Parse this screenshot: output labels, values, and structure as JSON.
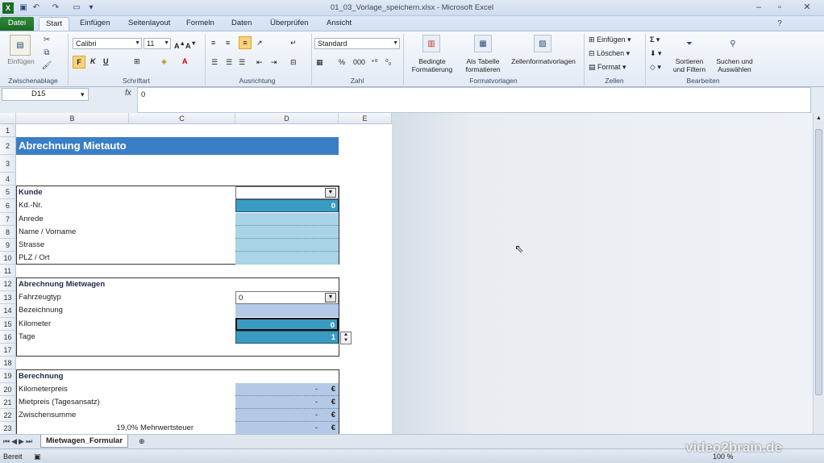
{
  "window": {
    "title": "01_03_Vorlage_speichern.xlsx - Microsoft Excel"
  },
  "tabs": [
    "Datei",
    "Start",
    "Einfügen",
    "Seitenlayout",
    "Formeln",
    "Daten",
    "Überprüfen",
    "Ansicht"
  ],
  "ribbon": {
    "clipboard": {
      "paste": "Einfügen",
      "group": "Zwischenablage"
    },
    "font": {
      "name": "Calibri",
      "size": "11",
      "bold": "F",
      "italic": "K",
      "underline": "U",
      "group": "Schriftart"
    },
    "alignment": {
      "group": "Ausrichtung"
    },
    "number": {
      "format": "Standard",
      "group": "Zahl"
    },
    "styles": {
      "conditional": "Bedingte\nFormatierung",
      "table": "Als Tabelle\nformatieren",
      "cellstyles": "Zellenformatvorlagen",
      "group": "Formatvorlagen"
    },
    "cells": {
      "insert": "Einfügen",
      "delete": "Löschen",
      "format": "Format",
      "group": "Zellen"
    },
    "editing": {
      "sort": "Sortieren\nund Filtern",
      "find": "Suchen und\nAuswählen",
      "group": "Bearbeiten"
    }
  },
  "formula_bar": {
    "name_box": "D15",
    "fx": "fx",
    "content": "0"
  },
  "columns": [
    "B",
    "C",
    "D",
    "E"
  ],
  "rows": [
    "1",
    "2",
    "3",
    "4",
    "5",
    "6",
    "7",
    "8",
    "9",
    "10",
    "11",
    "12",
    "13",
    "14",
    "15",
    "16",
    "17",
    "18",
    "19",
    "20",
    "21",
    "22",
    "23"
  ],
  "sheet": {
    "title": "Abrechnung Mietauto",
    "kunde": {
      "header": "Kunde",
      "labels": [
        "Kd.-Nr.",
        "Anrede",
        "Name / Vorname",
        "Strasse",
        "PLZ / Ort"
      ],
      "kdnr_value": "0"
    },
    "mietwagen": {
      "header": "Abrechnung Mietwagen",
      "labels": [
        "Fahrzeugtyp",
        "Bezeichnung",
        "Kilometer",
        "Tage"
      ],
      "fahrzeugtyp_value": "0",
      "kilometer_value": "0",
      "tage_value": "1"
    },
    "berechnung": {
      "header": "Berechnung",
      "labels": [
        "Kilometerpreis",
        "Mietpreis (Tagesansatz)",
        "Zwischensumme"
      ],
      "mwst_rate": "19,0%",
      "mwst_label": "Mehrwertsteuer",
      "dash": "-",
      "currency": "€"
    }
  },
  "sheet_tab": "Mietwagen_Formular",
  "status": {
    "ready": "Bereit",
    "zoom": "100 %"
  },
  "watermark": "video2brain.de",
  "colors": {
    "title_bg": "#3a7ec6",
    "input_light": "#a9d3e6",
    "input_dark": "#3a9bc2",
    "calc_bg": "#b3c9e6"
  }
}
